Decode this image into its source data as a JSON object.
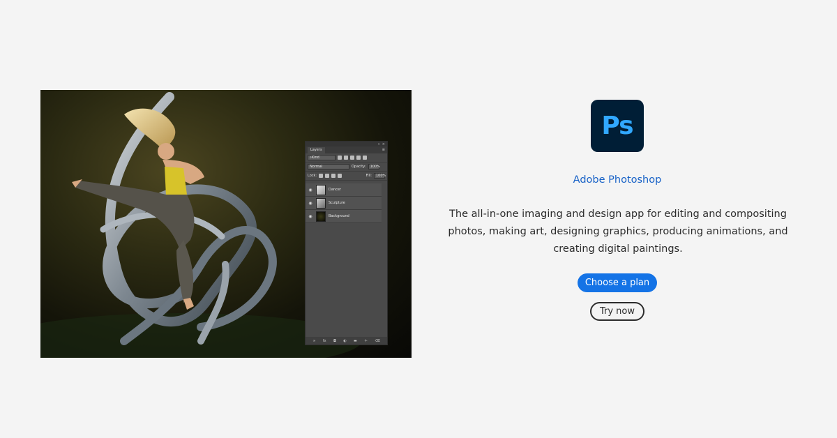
{
  "hero": {
    "layers_panel": {
      "tab_label": "Layers",
      "filter_label": "Kind",
      "blend_mode": "Normal",
      "opacity_label": "Opacity:",
      "opacity_value": "100%",
      "lock_label": "Lock:",
      "fill_label": "Fill:",
      "fill_value": "100%",
      "layers": [
        {
          "name": "Dancer"
        },
        {
          "name": "Sculpture"
        },
        {
          "name": "Background"
        }
      ],
      "footer_icons": [
        "link-icon",
        "fx-icon",
        "mask-icon",
        "adjustment-icon",
        "folder-icon",
        "new-layer-icon",
        "trash-icon"
      ]
    }
  },
  "app": {
    "logo_text": "Ps",
    "name": "Adobe Photoshop",
    "description": "The all-in-one imaging and design app for editing and compositing photos, making art, designing graphics, producing animations, and creating digital paintings.",
    "primary_cta": "Choose a plan",
    "secondary_cta": "Try now"
  },
  "colors": {
    "background": "#f4f4f4",
    "logo_bg": "#001e36",
    "logo_text": "#31a8ff",
    "link_blue": "#1862c7",
    "cta_blue": "#1473e6"
  }
}
